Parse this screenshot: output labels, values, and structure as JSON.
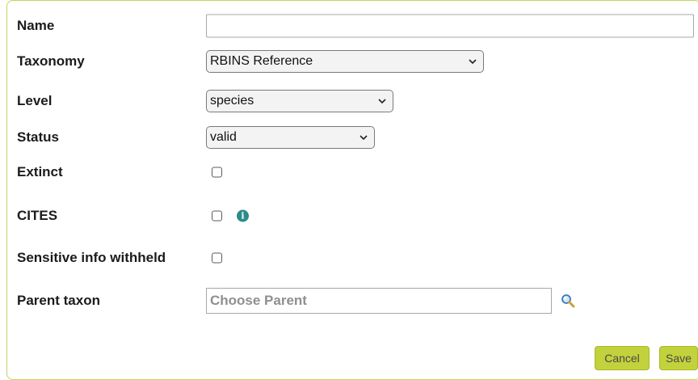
{
  "form": {
    "name": {
      "label": "Name",
      "value": ""
    },
    "taxonomy": {
      "label": "Taxonomy",
      "value": "RBINS Reference"
    },
    "level": {
      "label": "Level",
      "value": "species"
    },
    "status": {
      "label": "Status",
      "value": "valid"
    },
    "extinct": {
      "label": "Extinct",
      "checked": false
    },
    "cites": {
      "label": "CITES",
      "checked": false,
      "info_icon": "info-icon"
    },
    "sensitive": {
      "label": "Sensitive info withheld",
      "checked": false
    },
    "parent_taxon": {
      "label": "Parent taxon",
      "placeholder": "Choose Parent",
      "search_icon": "magnifier-icon"
    }
  },
  "actions": {
    "cancel_label": "Cancel",
    "save_label": "Save"
  },
  "colors": {
    "frame_border": "#c5d35a",
    "button_bg": "#c2d23c",
    "info_icon": "#2c8c8a"
  }
}
